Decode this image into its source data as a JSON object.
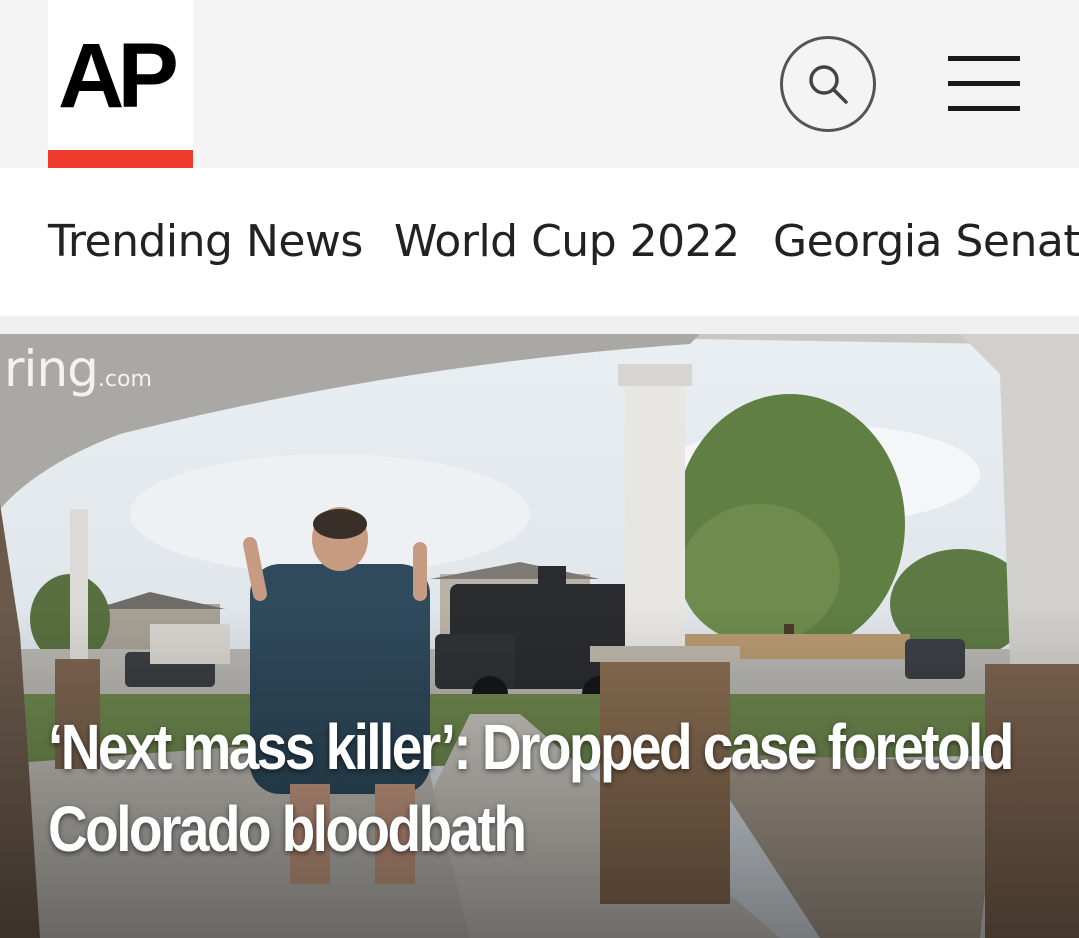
{
  "header": {
    "logo_text": "AP",
    "brand_red": "#ef3b2d",
    "search_icon": "search-icon",
    "menu_icon": "hamburger-menu-icon"
  },
  "nav": {
    "items": [
      {
        "label": "Trending News"
      },
      {
        "label": "World Cup 2022"
      },
      {
        "label": "Georgia Senate r"
      }
    ]
  },
  "hero": {
    "watermark_main": "ring",
    "watermark_suffix": ".com",
    "headline_line1": "‘Next mass killer’: Dropped case foretold",
    "headline_line2": "Colorado bloodbath"
  }
}
